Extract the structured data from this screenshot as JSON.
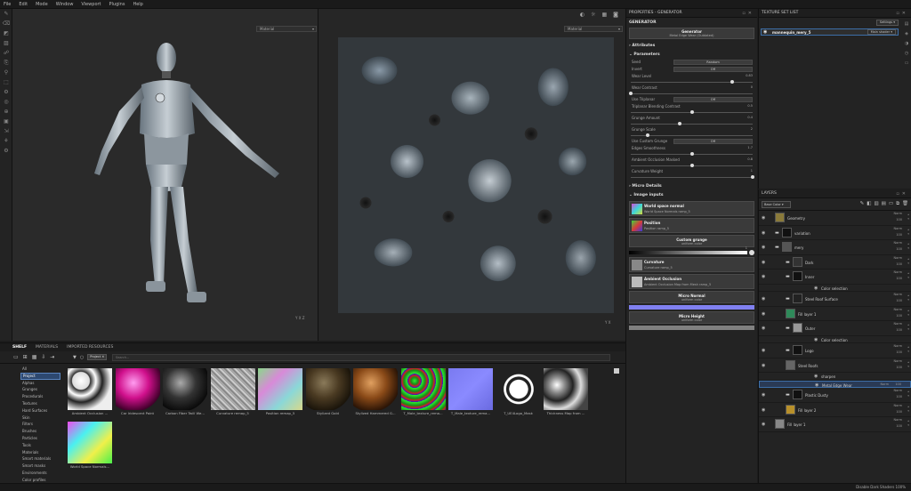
{
  "menu": [
    "File",
    "Edit",
    "Mode",
    "Window",
    "Viewport",
    "Plugins",
    "Help"
  ],
  "viewport3d": {
    "dropdown": "Material",
    "axis_y": "Y",
    "axis_x": "X",
    "axis_z": "Z"
  },
  "viewport2d": {
    "dropdown": "Material",
    "axis_y": "Y",
    "axis_x": "X"
  },
  "properties": {
    "title": "PROPERTIES - GENERATOR",
    "section": "GENERATOR",
    "generator_title": "Generator",
    "generator_sub": "Metal Edge Wear (Outdated)",
    "attributes": "Attributes",
    "parameters": "Parameters",
    "rows": [
      {
        "label": "Seed",
        "button": "Random"
      },
      {
        "label": "Invert",
        "button": "Off"
      },
      {
        "label": "Wear Level",
        "value": "0.83",
        "slider": 0.83
      },
      {
        "label": "Wear Contrast",
        "value": "0",
        "slider": 0.0
      },
      {
        "label": "Use Triplanar",
        "button": "Off"
      },
      {
        "label": "Triplanar Blending Contrast",
        "value": "0.5",
        "slider": 0.5
      },
      {
        "label": "Grunge Amount",
        "value": "0.4",
        "slider": 0.4
      },
      {
        "label": "Grunge Scale",
        "value": "2",
        "slider": 0.14
      },
      {
        "label": "Use Custom Grunge",
        "button": "Off"
      },
      {
        "label": "Edges Smoothness",
        "value": "1.7",
        "slider": 0.5
      },
      {
        "label": "Ambient Occlusion Masked",
        "value": "0.8",
        "slider": 0.5
      },
      {
        "label": "Curvature Weight",
        "value": "1",
        "slider": 1.0
      }
    ],
    "micro_details": "Micro Details",
    "image_inputs": "Image inputs",
    "wsn_title": "World space normal",
    "wsn_sub": "World Space Normals ramp_5",
    "pos_title": "Position",
    "pos_sub": "Position ramp_5",
    "custom_grunge_title": "Custom grunge",
    "custom_grunge_sub": "uniform color",
    "gradient_value": "1",
    "curvature_title": "Curvature",
    "curvature_sub": "Curvature ramp_5",
    "ao_title": "Ambient Occlusion",
    "ao_sub": "Ambient Occlusion Map from Mesh ramp_5",
    "micro_normal_title": "Micro Normal",
    "micro_normal_sub": "uniform color",
    "micro_height_title": "Micro Height",
    "micro_height_sub": "uniform color"
  },
  "texture_set_list": {
    "title": "TEXTURE SET LIST",
    "settings": "Settings",
    "item": "mannequin_mery_5",
    "shader": "Main shader"
  },
  "layers_panel": {
    "title": "LAYERS",
    "blend_select": "Base Color",
    "rows": [
      {
        "name": "Geometry",
        "blend": "Norm",
        "opacity": "100",
        "thumb": "#8a7a3a",
        "indent": 0,
        "folder": false
      },
      {
        "name": "variation",
        "blend": "Norm",
        "opacity": "100",
        "thumb": "#111111",
        "indent": 0,
        "folder": true
      },
      {
        "name": "mery",
        "blend": "Norm",
        "opacity": "100",
        "thumb": "#555555",
        "indent": 0,
        "folder": true
      },
      {
        "name": "Dark",
        "blend": "Norm",
        "opacity": "100",
        "thumb": "#333333",
        "indent": 1,
        "folder": true
      },
      {
        "name": "Inner",
        "blend": "Norm",
        "opacity": "100",
        "thumb": "#111111",
        "indent": 1,
        "folder": true
      },
      {
        "name": "Color selection",
        "blend": "",
        "opacity": "",
        "thumb": "",
        "indent": 2,
        "small": true
      },
      {
        "name": "Steel Roof Surface",
        "blend": "Norm",
        "opacity": "100",
        "thumb": "#222222",
        "indent": 1,
        "folder": true
      },
      {
        "name": "Fill layer 1",
        "blend": "Norm",
        "opacity": "100",
        "thumb": "#2f8a5a",
        "indent": 1,
        "folder": false
      },
      {
        "name": "Outer",
        "blend": "Norm",
        "opacity": "100",
        "thumb": "#999999",
        "indent": 1,
        "folder": true
      },
      {
        "name": "Color selection",
        "blend": "",
        "opacity": "",
        "thumb": "",
        "indent": 2,
        "small": true
      },
      {
        "name": "Logo",
        "blend": "Norm",
        "opacity": "100",
        "thumb": "#111111",
        "indent": 1,
        "folder": true
      },
      {
        "name": "Steel Roofs",
        "blend": "Norm",
        "opacity": "100",
        "thumb": "#666666",
        "indent": 1,
        "folder": false
      },
      {
        "name": "sharpen",
        "blend": "",
        "opacity": "",
        "thumb": "",
        "indent": 2,
        "small": true
      },
      {
        "name": "Metal Edge Wear",
        "blend": "Norm",
        "opacity": "100",
        "thumb": "",
        "indent": 2,
        "small": true,
        "highlight": true
      },
      {
        "name": "Plastic Dusty",
        "blend": "Norm",
        "opacity": "100",
        "thumb": "#111111",
        "indent": 1,
        "folder": true
      },
      {
        "name": "Fill layer 2",
        "blend": "Norm",
        "opacity": "100",
        "thumb": "#b8902a",
        "indent": 1,
        "folder": false
      },
      {
        "name": "Fill layer 1",
        "blend": "Norm",
        "opacity": "100",
        "thumb": "#888888",
        "indent": 0,
        "folder": false
      }
    ]
  },
  "shelf": {
    "tabs": [
      "SHELF",
      "MATERIALS",
      "IMPORTED RESOURCES"
    ],
    "filter_chip": "Project",
    "search_placeholder": "Search...",
    "categories": [
      "All",
      "Project",
      "Alphas",
      "Grunges",
      "Procedurals",
      "Textures",
      "Hard Surfaces",
      "Skin",
      "Filters",
      "Brushes",
      "Particles",
      "Tools",
      "Materials",
      "Smart materials",
      "Smart masks",
      "Environments",
      "Color profiles"
    ],
    "assets": [
      {
        "label": "Ambient Occlusion ...",
        "kind": "ao"
      },
      {
        "label": "Car Iridescent Paint",
        "kind": "pink"
      },
      {
        "label": "Carbon Fiber Twill We...",
        "kind": "carbon"
      },
      {
        "label": "Curvature remap_5",
        "kind": "curv"
      },
      {
        "label": "Position remap_5",
        "kind": "pos"
      },
      {
        "label": "Stylized Gold",
        "kind": "gold"
      },
      {
        "label": "Stylized Hammered G...",
        "kind": "copper"
      },
      {
        "label": "T_Male_texture_rema...",
        "kind": "green"
      },
      {
        "label": "T_Male_texture_rema...",
        "kind": "blue"
      },
      {
        "label": "T_UE4Logo_Mask",
        "kind": "logo"
      },
      {
        "label": "Thickness Map from ...",
        "kind": "thick"
      },
      {
        "label": "World Space Normals...",
        "kind": "wsn"
      }
    ]
  },
  "status": {
    "right": "Disable Dark Shaders  100%"
  }
}
